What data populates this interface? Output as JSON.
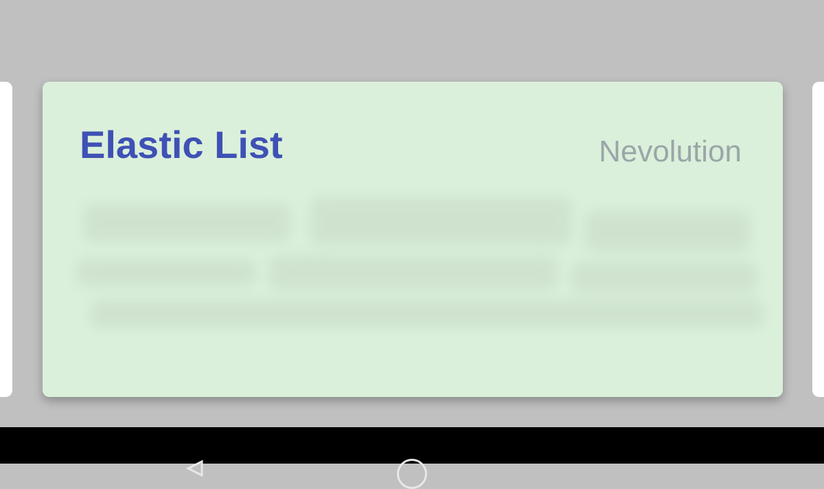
{
  "card": {
    "title": "Elastic List",
    "author": "Nevolution"
  },
  "colors": {
    "background": "#c0c0c0",
    "card_background": "#daf0da",
    "title_color": "#3f51b5",
    "author_color": "#9aa6a8",
    "navbar": "#000000"
  },
  "icons": {
    "back": "back-triangle-icon",
    "home": "home-circle-icon"
  }
}
